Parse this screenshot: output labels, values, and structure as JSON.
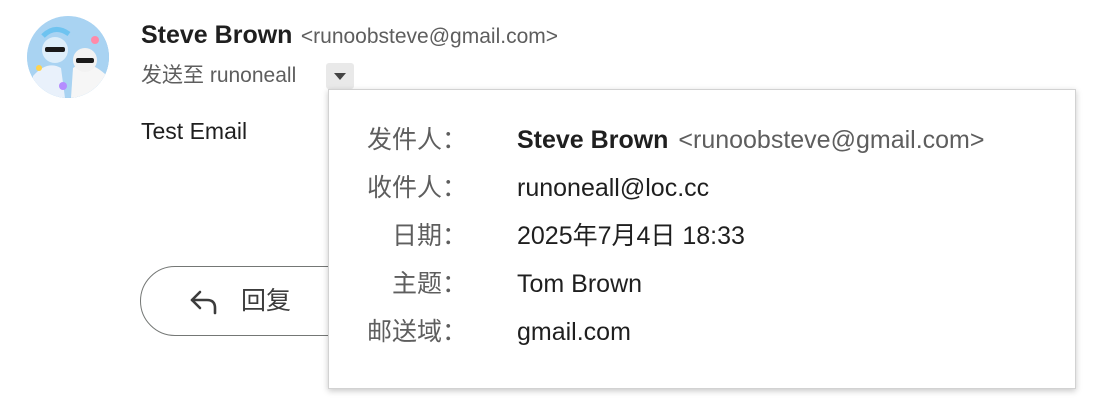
{
  "sender": {
    "name": "Steve Brown",
    "email": "<runoobsteve@gmail.com>"
  },
  "to_line": "发送至 runoneall",
  "body": {
    "text": "Test Email"
  },
  "reply": {
    "label": "回复",
    "icon": "reply-arrow-icon"
  },
  "details": {
    "from_label": "发件人：",
    "from_name": "Steve Brown",
    "from_email": "<runoobsteve@gmail.com>",
    "to_label": "收件人：",
    "to_value": "runoneall@loc.cc",
    "date_label": "日期：",
    "date_value": "2025年7月4日 18:33",
    "subject_label": "主题：",
    "subject_value": "Tom Brown",
    "mailed_by_label": "邮送域：",
    "mailed_by_value": "gmail.com"
  },
  "colors": {
    "text_primary": "#1f1f1f",
    "text_secondary": "#5e5e5e",
    "button_border": "#747775"
  }
}
